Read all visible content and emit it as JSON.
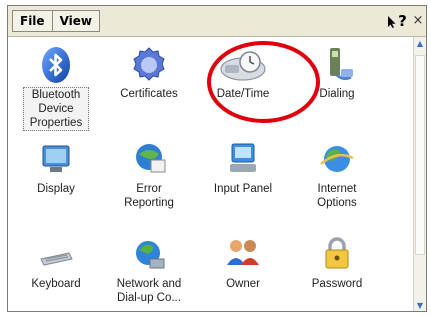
{
  "menu": {
    "file": "File",
    "view": "View"
  },
  "window_buttons": {
    "help": "?",
    "close": "×"
  },
  "items": [
    {
      "label": "Bluetooth Device Properties",
      "icon": "bluetooth-icon"
    },
    {
      "label": "Certificates",
      "icon": "certificates-icon"
    },
    {
      "label": "Date/Time",
      "icon": "date-time-icon"
    },
    {
      "label": "Dialing",
      "icon": "dialing-icon"
    },
    {
      "label": "Display",
      "icon": "display-icon"
    },
    {
      "label": "Error Reporting",
      "icon": "error-reporting-icon"
    },
    {
      "label": "Input Panel",
      "icon": "input-panel-icon"
    },
    {
      "label": "Internet Options",
      "icon": "internet-options-icon"
    },
    {
      "label": "Keyboard",
      "icon": "keyboard-icon"
    },
    {
      "label": "Network and Dial-up Co...",
      "icon": "network-icon"
    },
    {
      "label": "Owner",
      "icon": "owner-icon"
    },
    {
      "label": "Password",
      "icon": "password-icon"
    }
  ],
  "colors": {
    "highlight_circle": "#e0000c",
    "menubar": "#ece9d8"
  }
}
